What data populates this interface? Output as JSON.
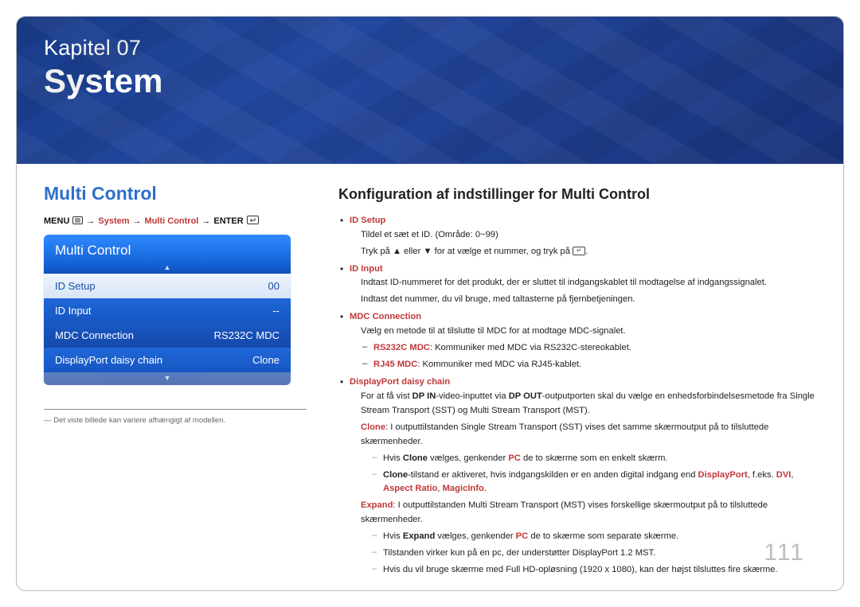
{
  "hero": {
    "chapter": "Kapitel 07",
    "title": "System"
  },
  "left": {
    "heading": "Multi Control",
    "breadcrumb": {
      "menu": "MENU",
      "system": "System",
      "mc": "Multi Control",
      "enter": "ENTER"
    },
    "osd": {
      "title": "Multi Control",
      "rows": [
        {
          "label": "ID Setup",
          "value": "00"
        },
        {
          "label": "ID Input",
          "value": "--"
        },
        {
          "label": "MDC Connection",
          "value": "RS232C MDC"
        },
        {
          "label": "DisplayPort daisy chain",
          "value": "Clone"
        }
      ]
    },
    "footnote": "Det viste billede kan variere afhængigt af modellen."
  },
  "right": {
    "heading": "Konfiguration af indstillinger for Multi Control",
    "id_setup": {
      "title": "ID Setup",
      "line1": "Tildel et sæt et ID.  (Område: 0~99)",
      "line2a": "Tryk på ",
      "line2b": " eller ",
      "line2c": " for at vælge et nummer, og tryk på ",
      "line2d": "."
    },
    "id_input": {
      "title": "ID Input",
      "line1": "Indtast ID-nummeret for det produkt, der er sluttet til indgangskablet til modtagelse af indgangssignalet.",
      "line2": "Indtast det nummer, du vil bruge, med taltasterne på fjernbetjeningen."
    },
    "mdc": {
      "title": "MDC Connection",
      "intro": "Vælg en metode til at tilslutte til MDC for at modtage MDC-signalet.",
      "rs": {
        "label": "RS232C MDC",
        "text": ": Kommuniker med MDC via RS232C-stereokablet."
      },
      "rj": {
        "label": "RJ45 MDC",
        "text": ": Kommuniker med MDC via RJ45-kablet."
      }
    },
    "dp": {
      "title": "DisplayPort daisy chain",
      "intro_a": "For at få vist ",
      "intro_b": "DP IN",
      "intro_c": "-video-inputtet via ",
      "intro_d": "DP OUT",
      "intro_e": "-outputporten skal du vælge en enhedsforbindelsesmetode fra Single Stream Transport (SST) og Multi Stream Transport (MST).",
      "clone_a": "Clone",
      "clone_b": ": I outputtilstanden Single Stream Transport (SST) vises det samme skærmoutput på to tilsluttede skærmenheder.",
      "n1a": "Hvis ",
      "n1b": "Clone",
      "n1c": " vælges, genkender ",
      "n1d": "PC",
      "n1e": " de to skærme som en enkelt skærm.",
      "n2a": "Clone",
      "n2b": "-tilstand er aktiveret, hvis indgangskilden er en anden digital indgang end ",
      "n2c": "DisplayPort",
      "n2d": ", f.eks. ",
      "n2e": "DVI",
      "n2f": ", ",
      "n2g": "Aspect Ratio",
      "n2h": ", ",
      "n2i": "MagicInfo",
      "n2j": ".",
      "expand_a": "Expand",
      "expand_b": ": I outputtilstanden Multi Stream Transport (MST) vises forskellige skærmoutput på to tilsluttede skærmenheder.",
      "n3a": "Hvis ",
      "n3b": "Expand",
      "n3c": " vælges, genkender ",
      "n3d": "PC",
      "n3e": " de to skærme som separate skærme.",
      "n4": "Tilstanden virker kun på en pc, der understøtter DisplayPort 1.2 MST.",
      "n5": "Hvis du vil bruge skærme med Full HD-opløsning (1920 x 1080), kan der højst tilsluttes fire skærme."
    }
  },
  "page_number": "111"
}
